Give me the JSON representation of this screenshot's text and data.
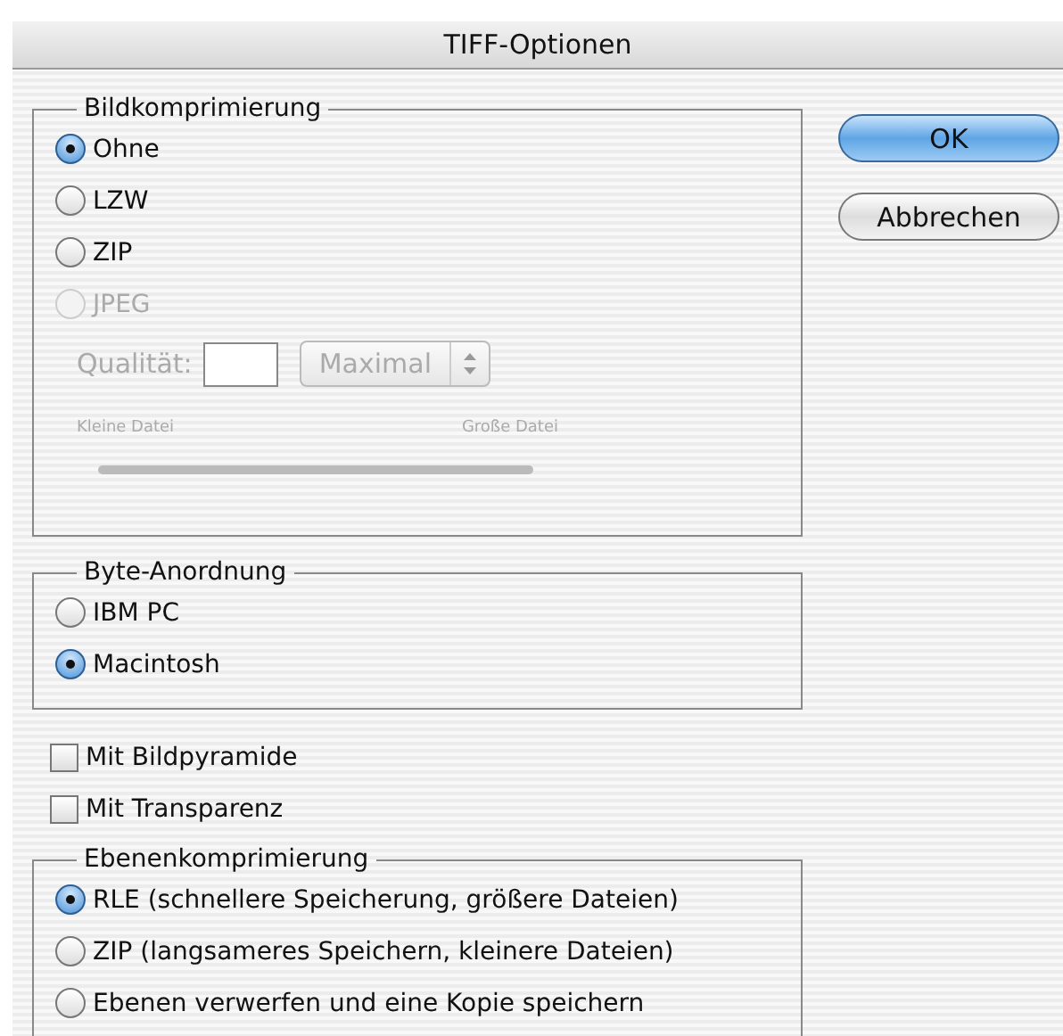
{
  "window": {
    "title": "TIFF-Optionen"
  },
  "image_compression": {
    "title": "Bildkomprimierung",
    "options": [
      {
        "label": "Ohne",
        "selected": true,
        "disabled": false
      },
      {
        "label": "LZW",
        "selected": false,
        "disabled": false
      },
      {
        "label": "ZIP",
        "selected": false,
        "disabled": false
      },
      {
        "label": "JPEG",
        "selected": false,
        "disabled": true
      }
    ],
    "quality": {
      "label": "Qualität:",
      "dropdown": "Maximal",
      "small_label": "Kleine Datei",
      "large_label": "Große Datei",
      "disabled": true
    }
  },
  "byte_order": {
    "title": "Byte-Anordnung",
    "options": [
      {
        "label": "IBM PC",
        "selected": false,
        "disabled": false
      },
      {
        "label": "Macintosh",
        "selected": true,
        "disabled": false
      }
    ]
  },
  "checkboxes": [
    {
      "label": "Mit Bildpyramide",
      "checked": false
    },
    {
      "label": "Mit Transparenz",
      "checked": false
    }
  ],
  "layer_compression": {
    "title": "Ebenenkomprimierung",
    "options": [
      {
        "label": "RLE (schnellere Speicherung, größere Dateien)",
        "selected": true,
        "disabled": false
      },
      {
        "label": "ZIP (langsameres Speichern, kleinere Dateien)",
        "selected": false,
        "disabled": false
      },
      {
        "label": "Ebenen verwerfen und eine Kopie speichern",
        "selected": false,
        "disabled": false
      }
    ]
  },
  "buttons": [
    {
      "label": "OK",
      "default": true
    },
    {
      "label": "Abbrechen",
      "default": false
    }
  ]
}
